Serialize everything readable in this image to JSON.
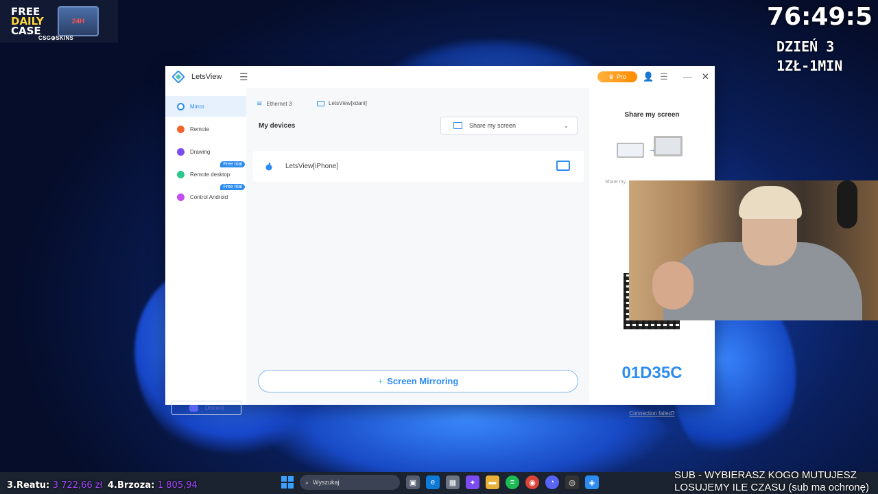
{
  "overlay": {
    "promo": {
      "line1": "FREE",
      "line2": "DAILY",
      "line3": "CASE",
      "box_label": "24H",
      "brand": "CSG⊕SKINS"
    },
    "timer": "76:49:5",
    "day_line1": "DZIEŃ 3",
    "day_line2": "1ZŁ-1MIN",
    "leaderboard": [
      {
        "label": "3.Reatu:",
        "amount": "3 722,66 zł"
      },
      {
        "label": "4.Brzoza:",
        "amount": "1 805,94"
      }
    ],
    "sub_line1": "SUB - WYBIERASZ KOGO MUTUJESZ",
    "sub_line2": "LOSUJEMY ILE CZASU (sub ma ochronę)"
  },
  "app": {
    "title": "LetsView",
    "pro_label": "Pro",
    "sidebar": {
      "items": [
        {
          "label": "Mirror",
          "color": "#2d8cf0",
          "badge": ""
        },
        {
          "label": "Remote",
          "color": "#f0652d",
          "badge": ""
        },
        {
          "label": "Drawing",
          "color": "#7a4cf0",
          "badge": ""
        },
        {
          "label": "Remote desktop",
          "color": "#2dc98c",
          "badge": "Free trial"
        },
        {
          "label": "Control Android",
          "color": "#c44cf0",
          "badge": "Free trial"
        }
      ],
      "discord_label": "Discord"
    },
    "main": {
      "network_label": "Ethernet 3",
      "pc_label": "LetsView[xdani]",
      "my_devices": "My devices",
      "share_dropdown": "Share my screen",
      "device_name": "LetsView[iPhone]",
      "mirror_button": "Screen Mirroring",
      "mirror_plus": "+"
    },
    "right_panel": {
      "title": "Share my screen",
      "sub": "Share my",
      "code": "01D35C",
      "connection_failed": "Connection failed?"
    }
  },
  "taskbar": {
    "search_placeholder": "Wyszukaj"
  }
}
